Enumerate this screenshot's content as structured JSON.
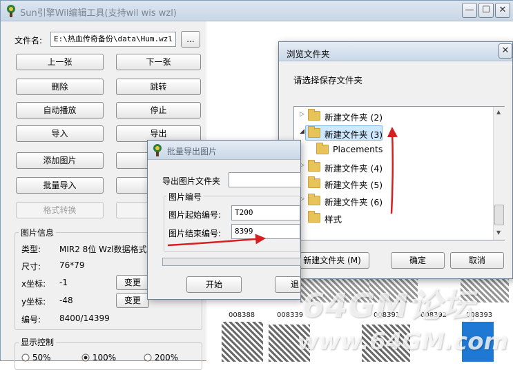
{
  "main": {
    "title": "Sun引擎Wil编辑工具(支持wil wis wzl)",
    "file_label": "文件名:",
    "file_value": "E:\\热血传奇备份\\data\\Hum.wzl",
    "browse_label": "...",
    "buttons": {
      "prev": "上一张",
      "next": "下一张",
      "delete": "删除",
      "jump": "跳转",
      "autoplay": "自动播放",
      "stop": "停止",
      "import": "导入",
      "export": "导出",
      "add_image": "添加图片",
      "create": "创",
      "batch_import": "批量导入",
      "batch_other": "批",
      "format_convert": "格式转换",
      "replace": "替"
    },
    "info": {
      "title": "图片信息",
      "type_label": "类型:",
      "type_value": "MIR2 8位 Wzl数据格式",
      "size_label": "尺寸:",
      "size_value": "76*79",
      "x_label": "x坐标:",
      "x_value": "-1",
      "y_label": "y坐标:",
      "y_value": "-48",
      "index_label": "编号:",
      "index_value": "8400/14399",
      "change_label": "变更"
    },
    "display": {
      "title": "显示控制",
      "options": [
        "50%",
        "100%",
        "200%"
      ],
      "selected": "100%"
    }
  },
  "preview": {
    "labels": [
      "008388",
      "008339",
      "008391",
      "008392",
      "008393"
    ]
  },
  "browse_dialog": {
    "title": "浏览文件夹",
    "prompt": "请选择保存文件夹",
    "tree": [
      {
        "label": "新建文件夹 (2)",
        "arrow": "▷",
        "indent": 0
      },
      {
        "label": "新建文件夹 (3)",
        "arrow": "◢",
        "indent": 0,
        "selected": true
      },
      {
        "label": "Placements",
        "arrow": "",
        "indent": 1
      },
      {
        "label": "新建文件夹 (4)",
        "arrow": "▷",
        "indent": 0
      },
      {
        "label": "新建文件夹 (5)",
        "arrow": "",
        "indent": 0
      },
      {
        "label": "新建文件夹 (6)",
        "arrow": "▷",
        "indent": 0
      },
      {
        "label": "样式",
        "arrow": "",
        "indent": 0
      }
    ],
    "new_folder": "新建文件夹 (M)",
    "ok": "确定",
    "cancel": "取消"
  },
  "batch_dialog": {
    "title": "批量导出图片",
    "folder_label": "导出图片文件夹",
    "group_title": "图片编号",
    "start_label": "图片起始编号:",
    "start_value": "T200",
    "end_label": "图片结束编号:",
    "end_value": "8399",
    "start_btn": "开始",
    "exit_btn": "退出"
  },
  "watermark": {
    "line1": "64GM论坛",
    "line2": "www.64GM.com"
  },
  "colors": {
    "annotation_arrow": "#d42020",
    "tree_selection": "#cde8ff"
  }
}
